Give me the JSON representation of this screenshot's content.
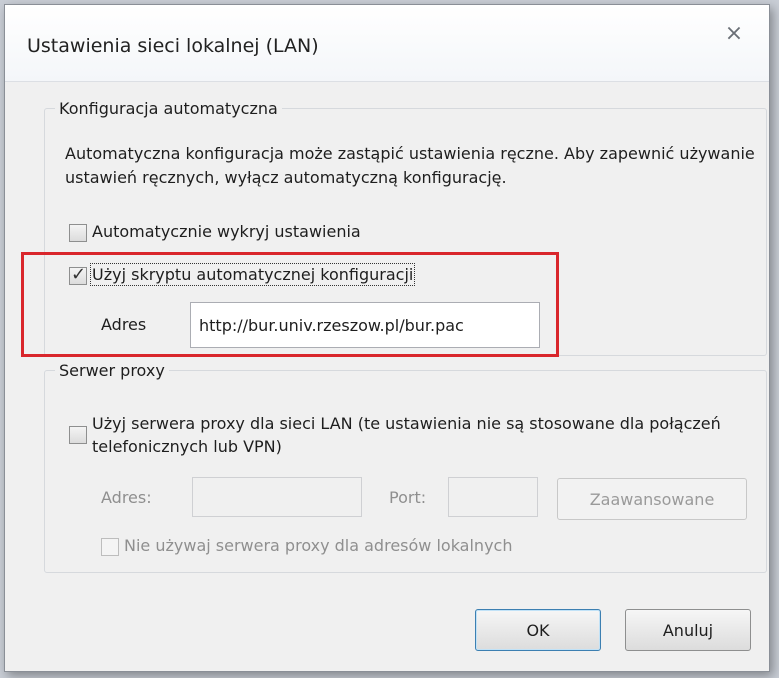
{
  "dialog": {
    "title": "Ustawienia sieci lokalnej (LAN)",
    "close_icon": "close-icon"
  },
  "auto_config": {
    "legend": "Konfiguracja automatyczna",
    "description": "Automatyczna konfiguracja może zastąpić ustawienia ręczne. Aby zapewnić używanie ustawień ręcznych, wyłącz automatyczną konfigurację.",
    "detect_label": "Automatycznie wykryj ustawienia",
    "detect_checked": false,
    "script_label": "Użyj skryptu automatycznej konfiguracji",
    "script_checked": true,
    "address_label": "Adres",
    "address_value": "http://bur.univ.rzeszow.pl/bur.pac"
  },
  "proxy": {
    "legend": "Serwer proxy",
    "use_proxy_label": "Użyj serwera proxy dla sieci LAN (te ustawienia nie są stosowane dla połączeń telefonicznych lub VPN)",
    "use_proxy_checked": false,
    "address_label": "Adres:",
    "address_value": "",
    "port_label": "Port:",
    "port_value": "",
    "advanced_button": "Zaawansowane",
    "bypass_label": "Nie używaj serwera proxy dla adresów lokalnych",
    "bypass_checked": false
  },
  "buttons": {
    "ok": "OK",
    "cancel": "Anuluj"
  },
  "colors": {
    "highlight": "#d9262c",
    "dialog_bg": "#f0f0f0"
  }
}
